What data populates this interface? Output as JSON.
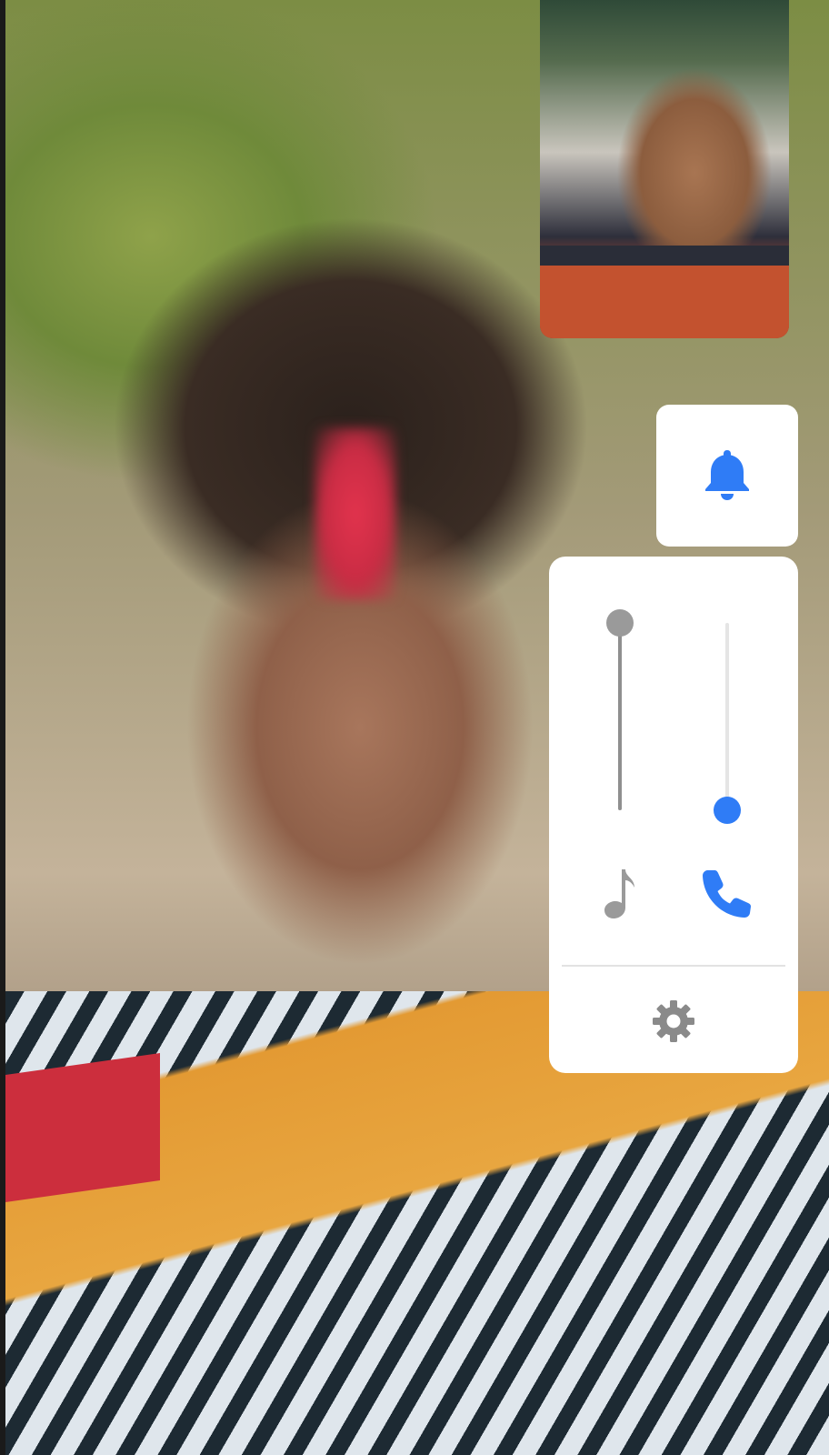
{
  "screen": {
    "type": "video-call",
    "overlay": "volume-controls"
  },
  "colors": {
    "accent": "#2f7cf6",
    "inactive": "#9a9a9a",
    "panel_bg": "#ffffff"
  },
  "notification_button": {
    "icon": "bell-icon",
    "color": "#2f7cf6"
  },
  "volume_panel": {
    "media_slider": {
      "icon": "music-note-icon",
      "level": 1.0,
      "color": "#9a9a9a"
    },
    "call_slider": {
      "icon": "phone-icon",
      "level": 0.0,
      "color": "#2f7cf6"
    },
    "settings": {
      "icon": "gear-icon",
      "color": "#8a8a8a"
    }
  }
}
